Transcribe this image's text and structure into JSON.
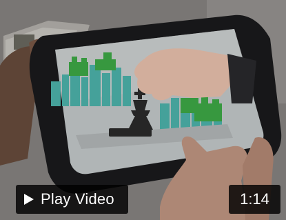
{
  "video": {
    "play_label": "Play Video",
    "duration": "1:14",
    "overlay_color": "#000000",
    "label_color": "#ffffff"
  },
  "thumbnail": {
    "scene_palette": {
      "screen": "#c9cfd0",
      "buildings_teal": "#4fb8b0",
      "buildings_green": "#3fae48",
      "chess_piece": "#2c2c2c",
      "tablet_frame": "#1b1b1d"
    }
  },
  "icons": {
    "play": "play-icon"
  }
}
